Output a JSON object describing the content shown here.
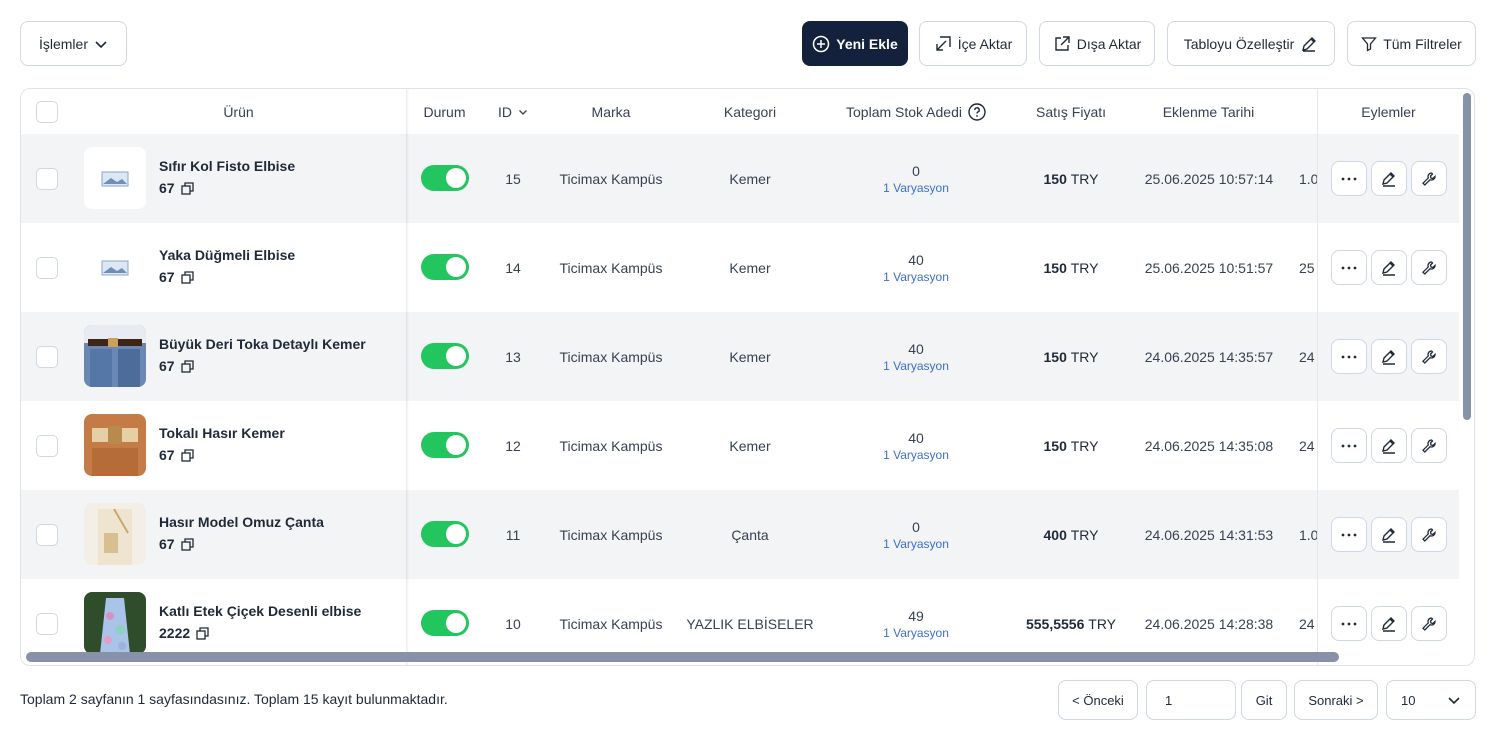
{
  "toolbar": {
    "actions_label": "İşlemler",
    "new_label": "Yeni Ekle",
    "import_label": "İçe Aktar",
    "export_label": "Dışa Aktar",
    "customize_label": "Tabloyu Özelleştir",
    "filters_label": "Tüm Filtreler"
  },
  "table": {
    "headers": {
      "product": "Ürün",
      "status": "Durum",
      "id": "ID",
      "brand": "Marka",
      "category": "Kategori",
      "stock": "Toplam Stok Adedi",
      "price": "Satış Fiyatı",
      "date": "Eklenme Tarihi",
      "actions": "Eylemler"
    },
    "rows": [
      {
        "name": "Sıfır Kol Fisto Elbise",
        "code": "67",
        "id": "15",
        "brand": "Ticimax Kampüs",
        "category": "Kemer",
        "stock": "0",
        "variation": "1 Varyasyon",
        "price_value": "150",
        "currency": "TRY",
        "date": "25.06.2025 10:57:14",
        "extra": "1.0"
      },
      {
        "name": "Yaka Düğmeli Elbise",
        "code": "67",
        "id": "14",
        "brand": "Ticimax Kampüs",
        "category": "Kemer",
        "stock": "40",
        "variation": "1 Varyasyon",
        "price_value": "150",
        "currency": "TRY",
        "date": "25.06.2025 10:51:57",
        "extra": "25"
      },
      {
        "name": "Büyük Deri Toka Detaylı Kemer",
        "code": "67",
        "id": "13",
        "brand": "Ticimax Kampüs",
        "category": "Kemer",
        "stock": "40",
        "variation": "1 Varyasyon",
        "price_value": "150",
        "currency": "TRY",
        "date": "24.06.2025 14:35:57",
        "extra": "24"
      },
      {
        "name": "Tokalı Hasır Kemer",
        "code": "67",
        "id": "12",
        "brand": "Ticimax Kampüs",
        "category": "Kemer",
        "stock": "40",
        "variation": "1 Varyasyon",
        "price_value": "150",
        "currency": "TRY",
        "date": "24.06.2025 14:35:08",
        "extra": "24"
      },
      {
        "name": "Hasır Model Omuz Çanta",
        "code": "67",
        "id": "11",
        "brand": "Ticimax Kampüs",
        "category": "Çanta",
        "stock": "0",
        "variation": "1 Varyasyon",
        "price_value": "400",
        "currency": "TRY",
        "date": "24.06.2025 14:31:53",
        "extra": "1.0"
      },
      {
        "name": "Katlı Etek Çiçek Desenli elbise",
        "code": "2222",
        "id": "10",
        "brand": "Ticimax Kampüs",
        "category": "YAZLIK ELBİSELER",
        "stock": "49",
        "variation": "1 Varyasyon",
        "price_value": "555,5556",
        "currency": "TRY",
        "date": "24.06.2025 14:28:38",
        "extra": "24"
      }
    ]
  },
  "footer": {
    "summary": "Toplam 2 sayfanın 1 sayfasındasınız. Toplam 15 kayıt bulunmaktadır.",
    "prev_label": "< Önceki",
    "page_value": "1",
    "go_label": "Git",
    "next_label": "Sonraki >",
    "page_size": "10"
  },
  "colors": {
    "primary": "#14213d",
    "toggle_on": "#22c55e",
    "link": "#3b6fd4",
    "row_alt": "#f3f4f6"
  },
  "icons": [
    "chevron-down-icon",
    "plus-circle-icon",
    "import-icon",
    "export-icon",
    "pencil-icon",
    "filter-icon",
    "help-circle-icon",
    "copy-icon",
    "more-icon",
    "edit-icon",
    "wrench-icon",
    "image-placeholder-icon"
  ]
}
